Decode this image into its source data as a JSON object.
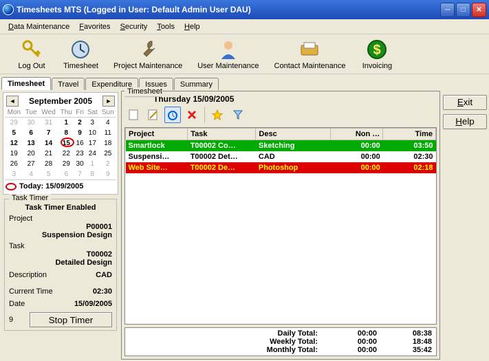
{
  "window": {
    "title": "Timesheets MTS (Logged in User: Default Admin User DAU)"
  },
  "menu": {
    "items": [
      "Data Maintenance",
      "Favorites",
      "Security",
      "Tools",
      "Help"
    ]
  },
  "toolbar": {
    "logout": "Log Out",
    "timesheet": "Timesheet",
    "project_maint": "Project Maintenance",
    "user_maint": "User Maintenance",
    "contact_maint": "Contact Maintenance",
    "invoicing": "Invoicing"
  },
  "tabs": {
    "items": [
      "Timesheet",
      "Travel",
      "Expenditure",
      "Issues",
      "Summary"
    ],
    "active": 0
  },
  "sidebuttons": {
    "exit": "Exit",
    "help": "Help"
  },
  "calendar": {
    "month_label": "September 2005",
    "dow": [
      "Mon",
      "Tue",
      "Wed",
      "Thu",
      "Fri",
      "Sat",
      "Sun"
    ],
    "weeks": [
      [
        {
          "d": "29",
          "dim": true
        },
        {
          "d": "30",
          "dim": true
        },
        {
          "d": "31",
          "dim": true
        },
        {
          "d": "1",
          "bold": true
        },
        {
          "d": "2",
          "bold": true
        },
        {
          "d": "3"
        },
        {
          "d": "4"
        }
      ],
      [
        {
          "d": "5",
          "bold": true
        },
        {
          "d": "6",
          "bold": true
        },
        {
          "d": "7",
          "bold": true
        },
        {
          "d": "8",
          "bold": true
        },
        {
          "d": "9",
          "bold": true
        },
        {
          "d": "10"
        },
        {
          "d": "11"
        }
      ],
      [
        {
          "d": "12",
          "bold": true
        },
        {
          "d": "13",
          "bold": true
        },
        {
          "d": "14",
          "bold": true
        },
        {
          "d": "15",
          "today": true
        },
        {
          "d": "16"
        },
        {
          "d": "17"
        },
        {
          "d": "18"
        }
      ],
      [
        {
          "d": "19"
        },
        {
          "d": "20"
        },
        {
          "d": "21"
        },
        {
          "d": "22"
        },
        {
          "d": "23"
        },
        {
          "d": "24"
        },
        {
          "d": "25"
        }
      ],
      [
        {
          "d": "26"
        },
        {
          "d": "27"
        },
        {
          "d": "28"
        },
        {
          "d": "29"
        },
        {
          "d": "30"
        },
        {
          "d": "1",
          "dim": true
        },
        {
          "d": "2",
          "dim": true
        }
      ],
      [
        {
          "d": "3",
          "dim": true
        },
        {
          "d": "4",
          "dim": true
        },
        {
          "d": "5",
          "dim": true
        },
        {
          "d": "6",
          "dim": true
        },
        {
          "d": "7",
          "dim": true
        },
        {
          "d": "8",
          "dim": true
        },
        {
          "d": "9",
          "dim": true
        }
      ]
    ],
    "today_label": "Today: 15/09/2005"
  },
  "task_timer": {
    "group_title": "Task Timer",
    "heading": "Task Timer Enabled",
    "project_label": "Project",
    "project_code": "P00001",
    "project_name": "Suspension Design",
    "task_label": "Task",
    "task_code": "T00002",
    "task_name": "Detailed Design",
    "desc_label": "Description",
    "desc_value": "CAD",
    "curtime_label": "Current Time",
    "curtime_value": "02:30",
    "date_label": "Date",
    "date_value": "15/09/2005",
    "counter": "9",
    "stop_label": "Stop Timer"
  },
  "timesheet": {
    "panel_title": "Timesheet",
    "date_header": "Thursday 15/09/2005",
    "columns": [
      "Project",
      "Task",
      "Desc",
      "Non …",
      "Time"
    ],
    "rows": [
      {
        "class": "green",
        "project": "Smartlock",
        "task": "T00002 Co…",
        "desc": "Sketching",
        "non": "00:00",
        "time": "03:50"
      },
      {
        "class": "white",
        "project": "Suspensi…",
        "task": "T00002 Det…",
        "desc": "CAD",
        "non": "00:00",
        "time": "02:30"
      },
      {
        "class": "red",
        "project": "Web Site…",
        "task": "T00002 De…",
        "desc": "Photoshop",
        "non": "00:00",
        "time": "02:18"
      }
    ],
    "totals": {
      "daily_label": "Daily Total:",
      "daily_non": "00:00",
      "daily_time": "08:38",
      "weekly_label": "Weekly Total:",
      "weekly_non": "00:00",
      "weekly_time": "18:48",
      "monthly_label": "Monthly Total:",
      "monthly_non": "00:00",
      "monthly_time": "35:42"
    }
  }
}
